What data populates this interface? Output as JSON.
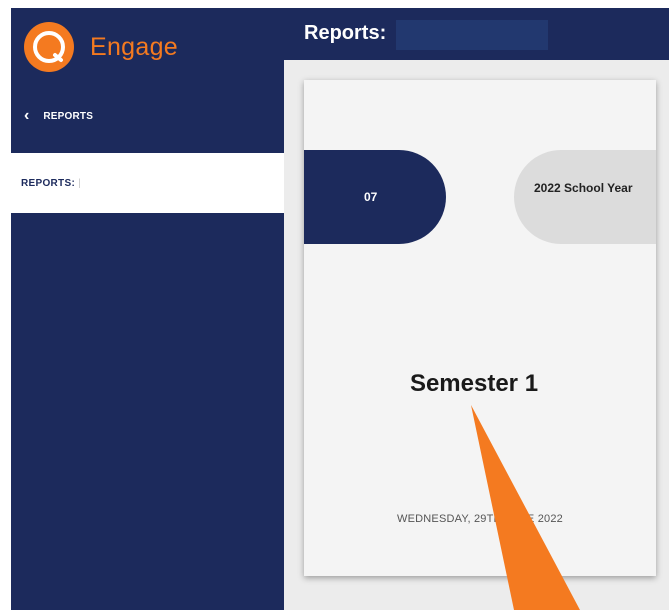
{
  "app": {
    "name": "Engage",
    "brand_color": "#f47a20",
    "nav_color": "#1c2a5c"
  },
  "sidebar": {
    "back_label": "REPORTS",
    "active_item": "REPORTS: ",
    "active_item_bar": "|"
  },
  "header": {
    "title": "Reports:"
  },
  "report_card": {
    "left_pill": "07",
    "right_pill": "2022 School Year",
    "title": "Semester 1",
    "date": "WEDNESDAY, 29TH JUNE 2022"
  },
  "icons": {
    "logo": "engage-logo-icon",
    "back": "chevron-left-icon",
    "annotation": "arrow-annotation"
  }
}
